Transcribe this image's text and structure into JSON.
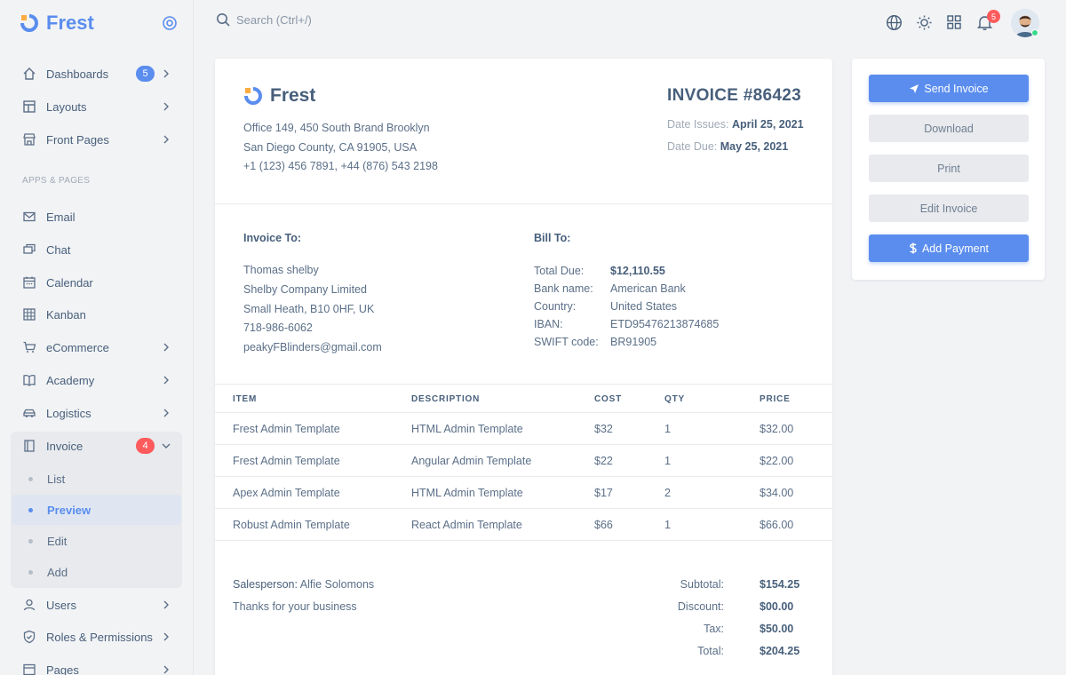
{
  "brand": {
    "name": "Frest"
  },
  "search": {
    "placeholder": "Search (Ctrl+/)"
  },
  "topbar": {
    "notification_count": "5"
  },
  "sidebar": {
    "items": [
      {
        "label": "Dashboards",
        "badge": "5"
      },
      {
        "label": "Layouts"
      },
      {
        "label": "Front Pages"
      }
    ],
    "section_heading": "APPS & PAGES",
    "apps": [
      {
        "label": "Email"
      },
      {
        "label": "Chat"
      },
      {
        "label": "Calendar"
      },
      {
        "label": "Kanban"
      },
      {
        "label": "eCommerce"
      },
      {
        "label": "Academy"
      },
      {
        "label": "Logistics"
      },
      {
        "label": "Invoice",
        "badge": "4"
      }
    ],
    "invoice_sub": [
      {
        "label": "List"
      },
      {
        "label": "Preview"
      },
      {
        "label": "Edit"
      },
      {
        "label": "Add"
      }
    ],
    "more": [
      {
        "label": "Users"
      },
      {
        "label": "Roles & Permissions"
      },
      {
        "label": "Pages"
      }
    ]
  },
  "invoice": {
    "brand": "Frest",
    "address": [
      "Office 149, 450 South Brand Brooklyn",
      "San Diego County, CA 91905, USA",
      "+1 (123) 456 7891, +44 (876) 543 2198"
    ],
    "title": "INVOICE #86423",
    "date_issued_label": "Date Issues:",
    "date_issued": "April 25, 2021",
    "date_due_label": "Date Due:",
    "date_due": "May 25, 2021",
    "invoice_to_label": "Invoice To:",
    "invoice_to": [
      "Thomas shelby",
      "Shelby Company Limited",
      "Small Heath, B10 0HF, UK",
      "718-986-6062",
      "peakyFBlinders@gmail.com"
    ],
    "bill_to_label": "Bill To:",
    "bill_to": [
      {
        "k": "Total Due:",
        "v": "$12,110.55"
      },
      {
        "k": "Bank name:",
        "v": "American Bank"
      },
      {
        "k": "Country:",
        "v": "United States"
      },
      {
        "k": "IBAN:",
        "v": "ETD95476213874685"
      },
      {
        "k": "SWIFT code:",
        "v": "BR91905"
      }
    ],
    "columns": [
      "ITEM",
      "DESCRIPTION",
      "COST",
      "QTY",
      "PRICE"
    ],
    "rows": [
      [
        "Frest Admin Template",
        "HTML Admin Template",
        "$32",
        "1",
        "$32.00"
      ],
      [
        "Frest Admin Template",
        "Angular Admin Template",
        "$22",
        "1",
        "$22.00"
      ],
      [
        "Apex Admin Template",
        "HTML Admin Template",
        "$17",
        "2",
        "$34.00"
      ],
      [
        "Robust Admin Template",
        "React Admin Template",
        "$66",
        "1",
        "$66.00"
      ]
    ],
    "salesperson_label": "Salesperson:",
    "salesperson": "Alfie Solomons",
    "thanks": "Thanks for your business",
    "totals": [
      {
        "k": "Subtotal:",
        "v": "$154.25"
      },
      {
        "k": "Discount:",
        "v": "$00.00"
      },
      {
        "k": "Tax:",
        "v": "$50.00"
      },
      {
        "k": "Total:",
        "v": "$204.25"
      }
    ]
  },
  "actions": {
    "send": "Send Invoice",
    "download": "Download",
    "print": "Print",
    "edit": "Edit Invoice",
    "add_payment": "Add Payment"
  }
}
